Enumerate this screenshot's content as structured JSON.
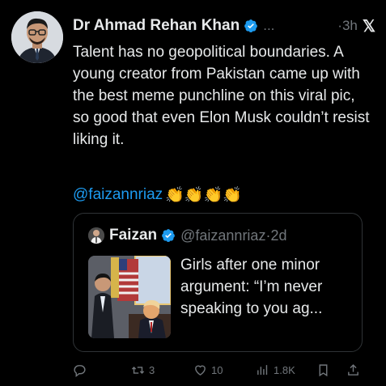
{
  "tweet": {
    "author_name": "Dr Ahmad Rehan Khan",
    "ellipsis": "...",
    "time": "·3h",
    "x_logo": "𝕏",
    "body": "Talent has no geopolitical boundaries. A young creator from Pakistan came up with the best meme punchline on this viral pic, so good that even Elon Musk couldn’t resist liking it.",
    "mention": "@faizannriaz",
    "emojis": "👏👏👏👏"
  },
  "quote": {
    "name": "Faizan",
    "handle": "@faizannriaz·2d",
    "text": "Girls after one minor argument: “I’m never speaking to you ag..."
  },
  "actions": {
    "reply": "",
    "retweets": "3",
    "likes": "10",
    "views": "1.8K"
  },
  "icons": {
    "verified": "verified-badge-icon",
    "reply": "reply-icon",
    "retweet": "retweet-icon",
    "like": "heart-icon",
    "views": "views-icon",
    "bookmark": "bookmark-icon",
    "share": "share-icon"
  },
  "colors": {
    "background": "#000000",
    "text": "#e7e9ea",
    "muted": "#71767b",
    "link": "#1d9bf0",
    "border": "#2f3336"
  }
}
